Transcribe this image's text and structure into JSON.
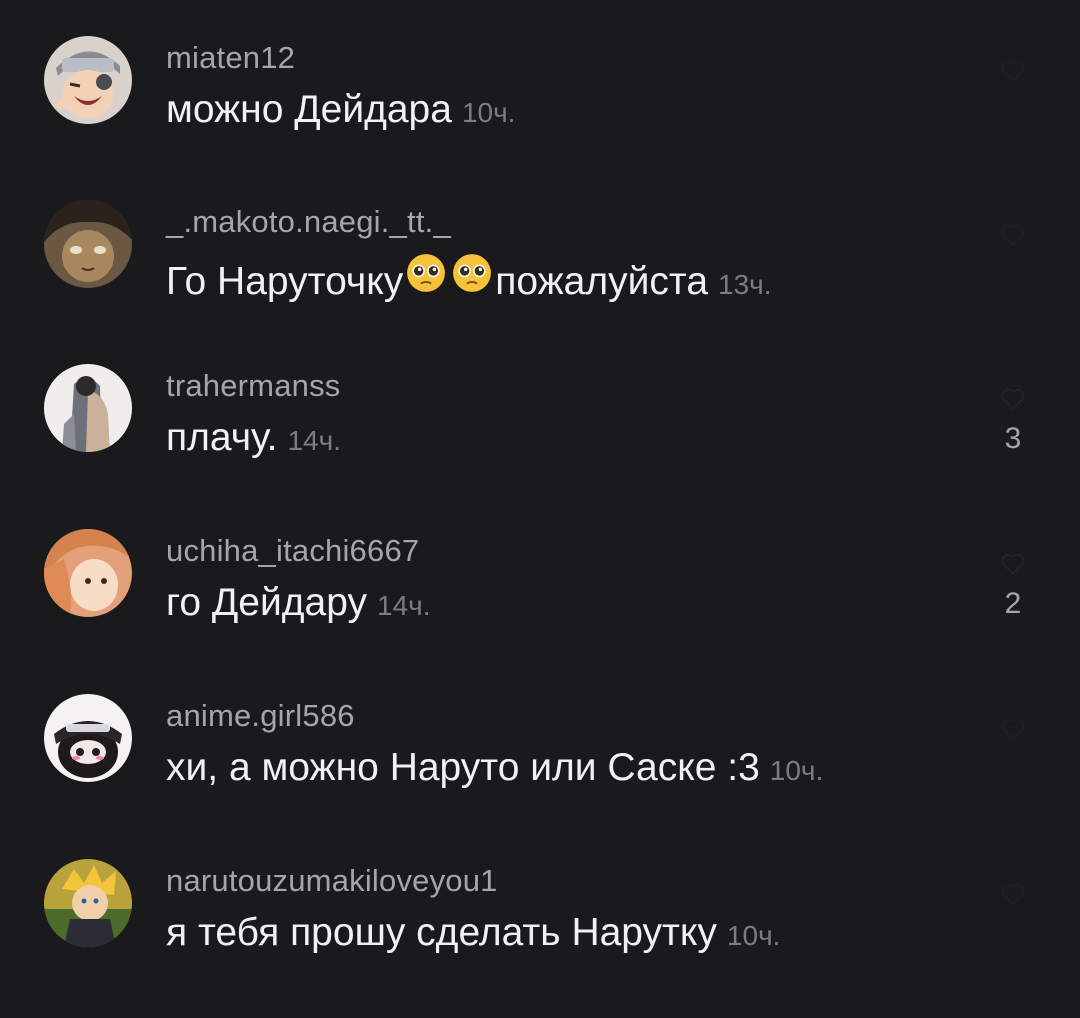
{
  "comments": [
    {
      "username": "miaten12",
      "text": "можно Дейдара",
      "time": "10ч.",
      "likes": ""
    },
    {
      "username": "_.makoto.naegi._tt._",
      "text": "Го Наруточку",
      "text_after": "пожалуйста",
      "emoji": "pleading-face",
      "time": "13ч.",
      "likes": ""
    },
    {
      "username": "trahermanss",
      "text": "плачу.",
      "time": "14ч.",
      "likes": "3"
    },
    {
      "username": "uchiha_itachi6667",
      "text": "го Дейдару",
      "time": "14ч.",
      "likes": "2"
    },
    {
      "username": "anime.girl586",
      "text": "хи, а можно Наруто или Саске :3",
      "time": "10ч.",
      "likes": ""
    },
    {
      "username": "narutouzumakiloveyou1",
      "text": "я тебя прошу сделать Нарутку",
      "time": "10ч.",
      "likes": ""
    }
  ],
  "colors": {
    "background": "#1a191b",
    "username": "#a6a5a9",
    "text": "#f1f0f2",
    "time": "#7d7c80"
  }
}
